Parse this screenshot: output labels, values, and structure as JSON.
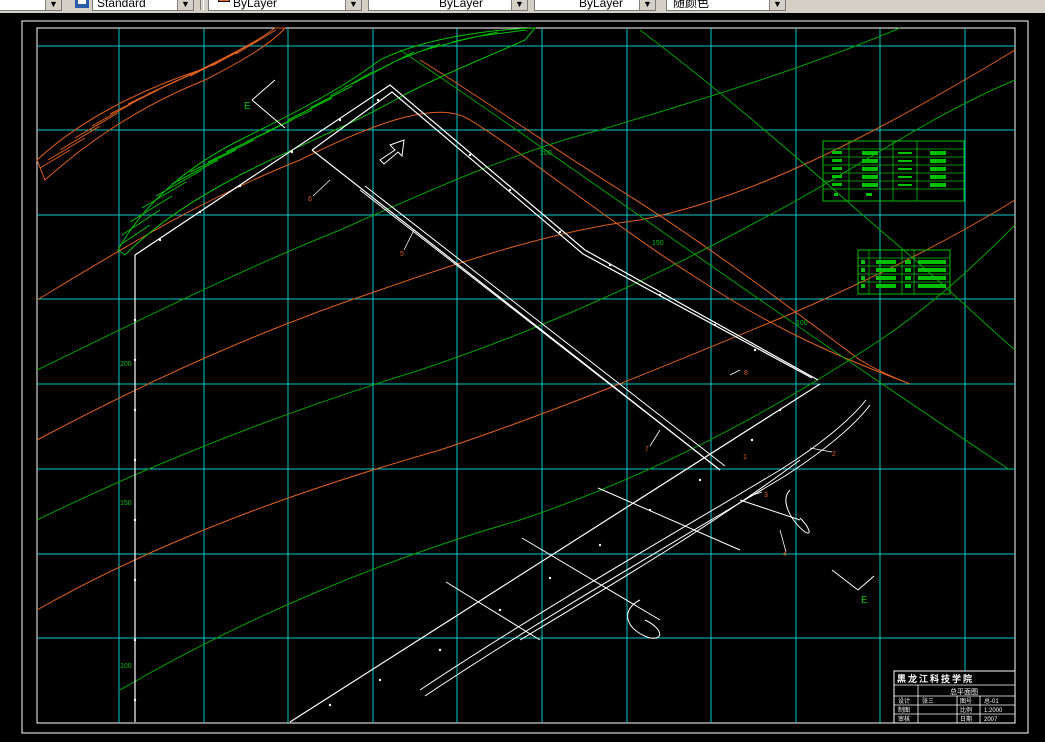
{
  "toolbar": {
    "text_style_value": "Standard",
    "layer_value": "ByLayer",
    "linetype_value": "ByLayer",
    "lineweight_value": "ByLayer",
    "plotstyle_value": "随颜色"
  },
  "drawing": {
    "section_mark_a": "E",
    "section_mark_b": "E",
    "contour_labels": [
      "200",
      "150",
      "100",
      "200",
      "150",
      "100"
    ],
    "item_labels": [
      "1",
      "2",
      "3",
      "4",
      "5",
      "6",
      "7",
      "8"
    ],
    "north_arrow": "N"
  },
  "title_block": {
    "institute": "黑龙江科技学院",
    "drawing_title": "总平面图",
    "row1_label": "设计",
    "row1_name": "张三",
    "row1_key": "图号",
    "row1_value": "总-01",
    "row2_label": "制图",
    "row2_key": "比例",
    "row2_value": "1:2000",
    "row3_label": "审核",
    "row3_key": "日期",
    "row3_value": "2007"
  },
  "colors": {
    "grid": "#00c8c8",
    "green_contour": "#00a000",
    "orange_contour": "#e06020",
    "lines": "#ffffff"
  }
}
